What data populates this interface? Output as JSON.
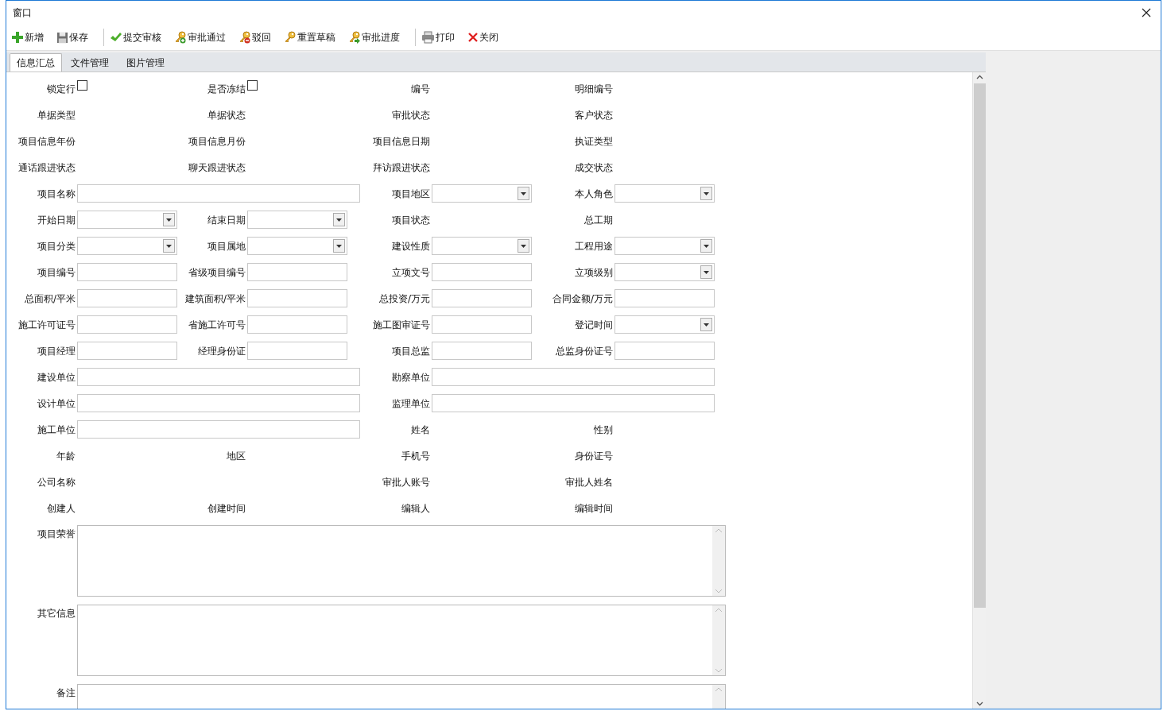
{
  "window": {
    "title": "窗口"
  },
  "toolbar": [
    [
      {
        "label": "新增",
        "kind": "add"
      },
      {
        "label": "保存",
        "kind": "save"
      }
    ],
    [
      {
        "label": "提交审核",
        "kind": "submit"
      },
      {
        "label": "审批通过",
        "kind": "approve"
      },
      {
        "label": "驳回",
        "kind": "reject"
      },
      {
        "label": "重置草稿",
        "kind": "reset"
      },
      {
        "label": "审批进度",
        "kind": "progress"
      }
    ],
    [
      {
        "label": "打印",
        "kind": "print"
      },
      {
        "label": "关闭",
        "kind": "close"
      }
    ]
  ],
  "tabs": [
    {
      "label": "信息汇总",
      "selected": true
    },
    {
      "label": "文件管理",
      "selected": false
    },
    {
      "label": "图片管理",
      "selected": false
    }
  ],
  "form": {
    "rows": [
      [
        {
          "label": "锁定行",
          "kind": "check",
          "checked": false
        },
        {
          "label": "是否冻结",
          "kind": "check",
          "checked": false
        },
        {
          "label": "编号",
          "kind": "label"
        },
        {
          "label": "明细编号",
          "kind": "label"
        }
      ],
      [
        {
          "label": "单据类型",
          "kind": "label"
        },
        {
          "label": "单据状态",
          "kind": "label"
        },
        {
          "label": "审批状态",
          "kind": "label"
        },
        {
          "label": "客户状态",
          "kind": "label"
        }
      ],
      [
        {
          "label": "项目信息年份",
          "kind": "label"
        },
        {
          "label": "项目信息月份",
          "kind": "label"
        },
        {
          "label": "项目信息日期",
          "kind": "label"
        },
        {
          "label": "执证类型",
          "kind": "label"
        }
      ],
      [
        {
          "label": "通话跟进状态",
          "kind": "label"
        },
        {
          "label": "聊天跟进状态",
          "kind": "label"
        },
        {
          "label": "拜访跟进状态",
          "kind": "label"
        },
        {
          "label": "成交状态",
          "kind": "label"
        }
      ],
      [
        {
          "label": "项目名称",
          "kind": "wide"
        },
        {
          "label": "项目地区",
          "kind": "select"
        },
        {
          "label": "本人角色",
          "kind": "select"
        }
      ],
      [
        {
          "label": "开始日期",
          "kind": "select"
        },
        {
          "label": "结束日期",
          "kind": "select"
        },
        {
          "label": "项目状态",
          "kind": "label"
        },
        {
          "label": "总工期",
          "kind": "label"
        }
      ],
      [
        {
          "label": "项目分类",
          "kind": "select"
        },
        {
          "label": "项目属地",
          "kind": "select"
        },
        {
          "label": "建设性质",
          "kind": "select"
        },
        {
          "label": "工程用途",
          "kind": "select"
        }
      ],
      [
        {
          "label": "项目编号",
          "kind": "input"
        },
        {
          "label": "省级项目编号",
          "kind": "input"
        },
        {
          "label": "立项文号",
          "kind": "input"
        },
        {
          "label": "立项级别",
          "kind": "select"
        }
      ],
      [
        {
          "label": "总面积/平米",
          "kind": "input"
        },
        {
          "label": "建筑面积/平米",
          "kind": "input"
        },
        {
          "label": "总投资/万元",
          "kind": "input"
        },
        {
          "label": "合同金额/万元",
          "kind": "input"
        }
      ],
      [
        {
          "label": "施工许可证号",
          "kind": "input"
        },
        {
          "label": "省施工许可号",
          "kind": "input"
        },
        {
          "label": "施工图审证号",
          "kind": "input"
        },
        {
          "label": "登记时间",
          "kind": "select"
        }
      ],
      [
        {
          "label": "项目经理",
          "kind": "input"
        },
        {
          "label": "经理身份证",
          "kind": "input"
        },
        {
          "label": "项目总监",
          "kind": "input"
        },
        {
          "label": "总监身份证号",
          "kind": "input"
        }
      ],
      [
        {
          "label": "建设单位",
          "kind": "wide"
        },
        {
          "label": "勘察单位",
          "kind": "wide"
        }
      ],
      [
        {
          "label": "设计单位",
          "kind": "wide"
        },
        {
          "label": "监理单位",
          "kind": "wide"
        }
      ],
      [
        {
          "label": "施工单位",
          "kind": "wide"
        },
        {
          "label": "姓名",
          "kind": "label"
        },
        {
          "label": "性别",
          "kind": "label"
        }
      ],
      [
        {
          "label": "年龄",
          "kind": "label"
        },
        {
          "label": "地区",
          "kind": "label"
        },
        {
          "label": "手机号",
          "kind": "label"
        },
        {
          "label": "身份证号",
          "kind": "label"
        }
      ],
      [
        {
          "label": "公司名称",
          "kind": "label"
        },
        {
          "kind": "empty"
        },
        {
          "label": "审批人账号",
          "kind": "label"
        },
        {
          "label": "审批人姓名",
          "kind": "label"
        }
      ],
      [
        {
          "label": "创建人",
          "kind": "label"
        },
        {
          "label": "创建时间",
          "kind": "label"
        },
        {
          "label": "编辑人",
          "kind": "label"
        },
        {
          "label": "编辑时间",
          "kind": "label"
        }
      ],
      [
        {
          "label": "项目荣誉",
          "kind": "memo"
        }
      ],
      [
        {
          "label": "其它信息",
          "kind": "memo"
        }
      ],
      [
        {
          "label": "备注",
          "kind": "memo"
        }
      ]
    ]
  }
}
